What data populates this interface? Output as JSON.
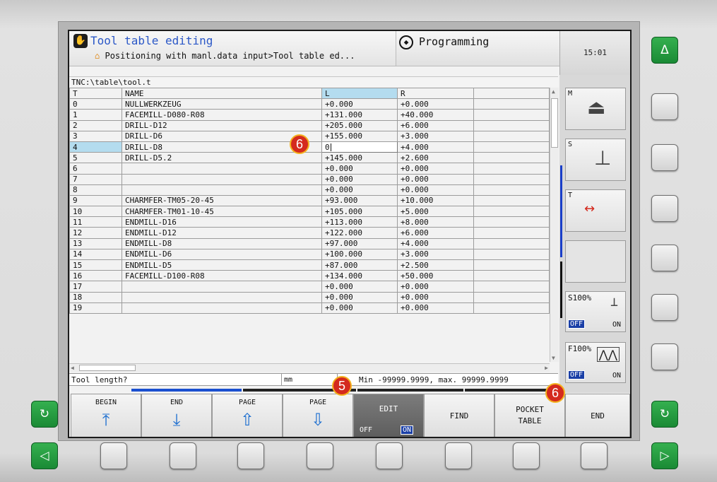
{
  "header": {
    "mode_icon": "hand-wheel-icon",
    "title": "Tool table editing",
    "subtitle": "Positioning with manl.data input>Tool table ed...",
    "programming_label": "Programming",
    "programming_icon": "programming-mode-icon",
    "clock": "15:01"
  },
  "path": "TNC:\\table\\tool.t",
  "table": {
    "columns": [
      "T",
      "NAME",
      "L",
      "R"
    ],
    "active_column": "L",
    "selected_row": "4",
    "edit_value": "0",
    "rows": [
      {
        "t": "0",
        "name": "NULLWERKZEUG",
        "l": "+0.000",
        "r": "+0.000"
      },
      {
        "t": "1",
        "name": "FACEMILL-D080-R08",
        "l": "+131.000",
        "r": "+40.000"
      },
      {
        "t": "2",
        "name": "DRILL-D12",
        "l": "+205.000",
        "r": "+6.000"
      },
      {
        "t": "3",
        "name": "DRILL-D6",
        "l": "+155.000",
        "r": "+3.000"
      },
      {
        "t": "4",
        "name": "DRILL-D8",
        "l": "0",
        "r": "+4.000"
      },
      {
        "t": "5",
        "name": "DRILL-D5.2",
        "l": "+145.000",
        "r": "+2.600"
      },
      {
        "t": "6",
        "name": "",
        "l": "+0.000",
        "r": "+0.000"
      },
      {
        "t": "7",
        "name": "",
        "l": "+0.000",
        "r": "+0.000"
      },
      {
        "t": "8",
        "name": "",
        "l": "+0.000",
        "r": "+0.000"
      },
      {
        "t": "9",
        "name": "CHARMFER-TM05-20-45",
        "l": "+93.000",
        "r": "+10.000"
      },
      {
        "t": "10",
        "name": "CHARMFER-TM01-10-45",
        "l": "+105.000",
        "r": "+5.000"
      },
      {
        "t": "11",
        "name": "ENDMILL-D16",
        "l": "+113.000",
        "r": "+8.000"
      },
      {
        "t": "12",
        "name": "ENDMILL-D12",
        "l": "+122.000",
        "r": "+6.000"
      },
      {
        "t": "13",
        "name": "ENDMILL-D8",
        "l": "+97.000",
        "r": "+4.000"
      },
      {
        "t": "14",
        "name": "ENDMILL-D6",
        "l": "+100.000",
        "r": "+3.000"
      },
      {
        "t": "15",
        "name": "ENDMILL-D5",
        "l": "+87.000",
        "r": "+2.500"
      },
      {
        "t": "16",
        "name": "FACEMILL-D100-R08",
        "l": "+134.000",
        "r": "+50.000"
      },
      {
        "t": "17",
        "name": "",
        "l": "+0.000",
        "r": "+0.000"
      },
      {
        "t": "18",
        "name": "",
        "l": "+0.000",
        "r": "+0.000"
      },
      {
        "t": "19",
        "name": "",
        "l": "+0.000",
        "r": "+0.000"
      }
    ]
  },
  "status": {
    "question": "Tool length?",
    "unit": "mm",
    "range": "Min -99999.9999, max. 99999.9999"
  },
  "softkeys": [
    {
      "label": "BEGIN",
      "icon": "arrow-up-bar-icon",
      "glyph": "⤒"
    },
    {
      "label": "END",
      "icon": "arrow-down-bar-icon",
      "glyph": "⤓"
    },
    {
      "label": "PAGE",
      "icon": "arrow-up-icon",
      "glyph": "⇧"
    },
    {
      "label": "PAGE",
      "icon": "arrow-down-icon",
      "glyph": "⇩"
    },
    {
      "label": "EDIT",
      "off": "OFF",
      "on": "ON"
    },
    {
      "label": "FIND"
    },
    {
      "label": "POCKET\nTABLE"
    },
    {
      "label": "END"
    }
  ],
  "side_panel": {
    "m_label": "M",
    "s_label": "S",
    "t_label": "T",
    "s_override": "S100%",
    "f_override": "F100%",
    "off_label": "OFF",
    "on_label": "ON"
  },
  "callouts": [
    "6",
    "5",
    "6"
  ],
  "hardware": {
    "top_right_key": "Δ",
    "left_softkey_switch": "↻",
    "right_softkey_switch": "↻",
    "bottom_left_key": "◁",
    "bottom_right_key": "▷"
  },
  "colors": {
    "accent_blue": "#2a57c7",
    "selection": "#b4dcef",
    "green_key": "#1f9a3c",
    "callout_red": "#d42a1e",
    "callout_ring": "#f4b21e"
  }
}
